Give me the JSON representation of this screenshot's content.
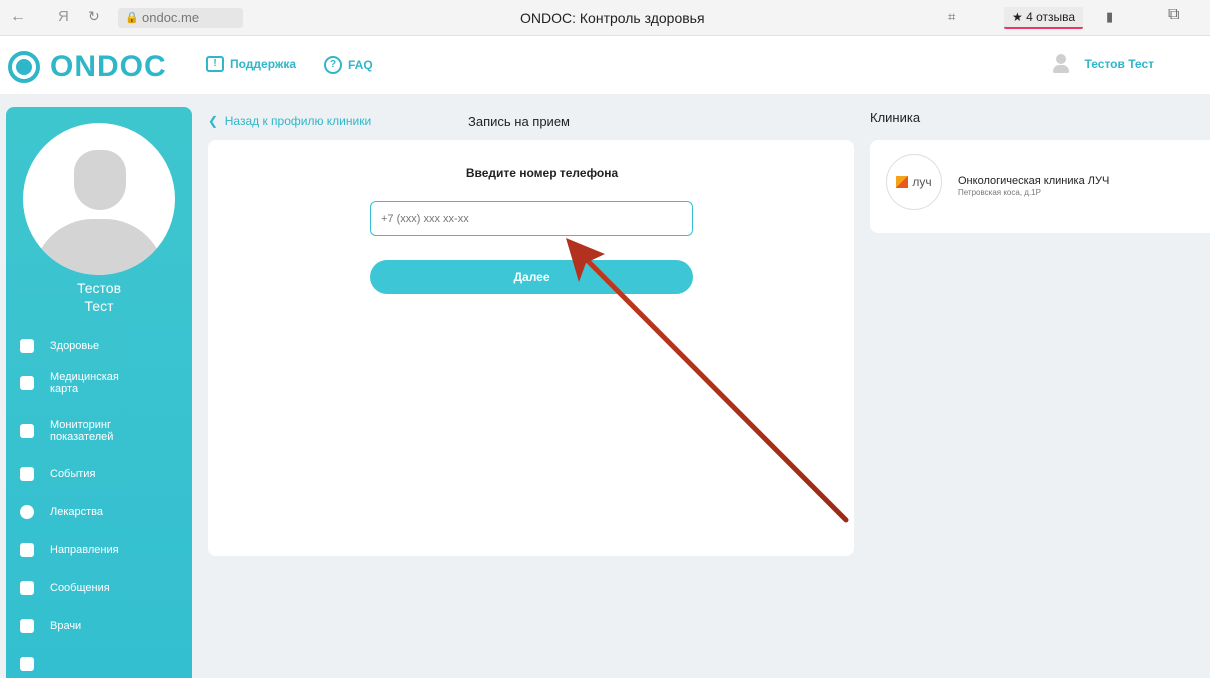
{
  "browser": {
    "url": "ondoc.me",
    "tab_title": "ONDOC: Контроль здоровья",
    "reviews": "★ 4 отзыва"
  },
  "header": {
    "logo": "ONDOC",
    "support": "Поддержка",
    "faq": "FAQ",
    "user": "Тестов Тест"
  },
  "sidebar": {
    "name_first": "Тестов",
    "name_last": "Тест",
    "items": [
      {
        "label": "Здоровье",
        "icon": "heart-icon"
      },
      {
        "label": "Медицинская карта",
        "icon": "medical-card-icon"
      },
      {
        "label": "Мониторинг показателей",
        "icon": "monitoring-icon"
      },
      {
        "label": "События",
        "icon": "calendar-icon"
      },
      {
        "label": "Лекарства",
        "icon": "pills-icon"
      },
      {
        "label": "Направления",
        "icon": "clipboard-icon"
      },
      {
        "label": "Сообщения",
        "icon": "chat-icon"
      },
      {
        "label": "Врачи",
        "icon": "doctor-icon"
      }
    ]
  },
  "main": {
    "back_link": "Назад к профилю клиники",
    "title": "Запись на прием",
    "prompt": "Введите номер телефона",
    "phone_placeholder": "+7 (xxx) xxx xx-xx",
    "next_button": "Далее"
  },
  "clinic": {
    "heading": "Клиника",
    "logo_text": "луч",
    "name": "Онкологическая клиника ЛУЧ",
    "address": "Петровская коса, д.1Р"
  },
  "colors": {
    "accent": "#2fb6c9",
    "sidebar": "#3ec6cf",
    "annotation_arrow": "#b3321f"
  }
}
